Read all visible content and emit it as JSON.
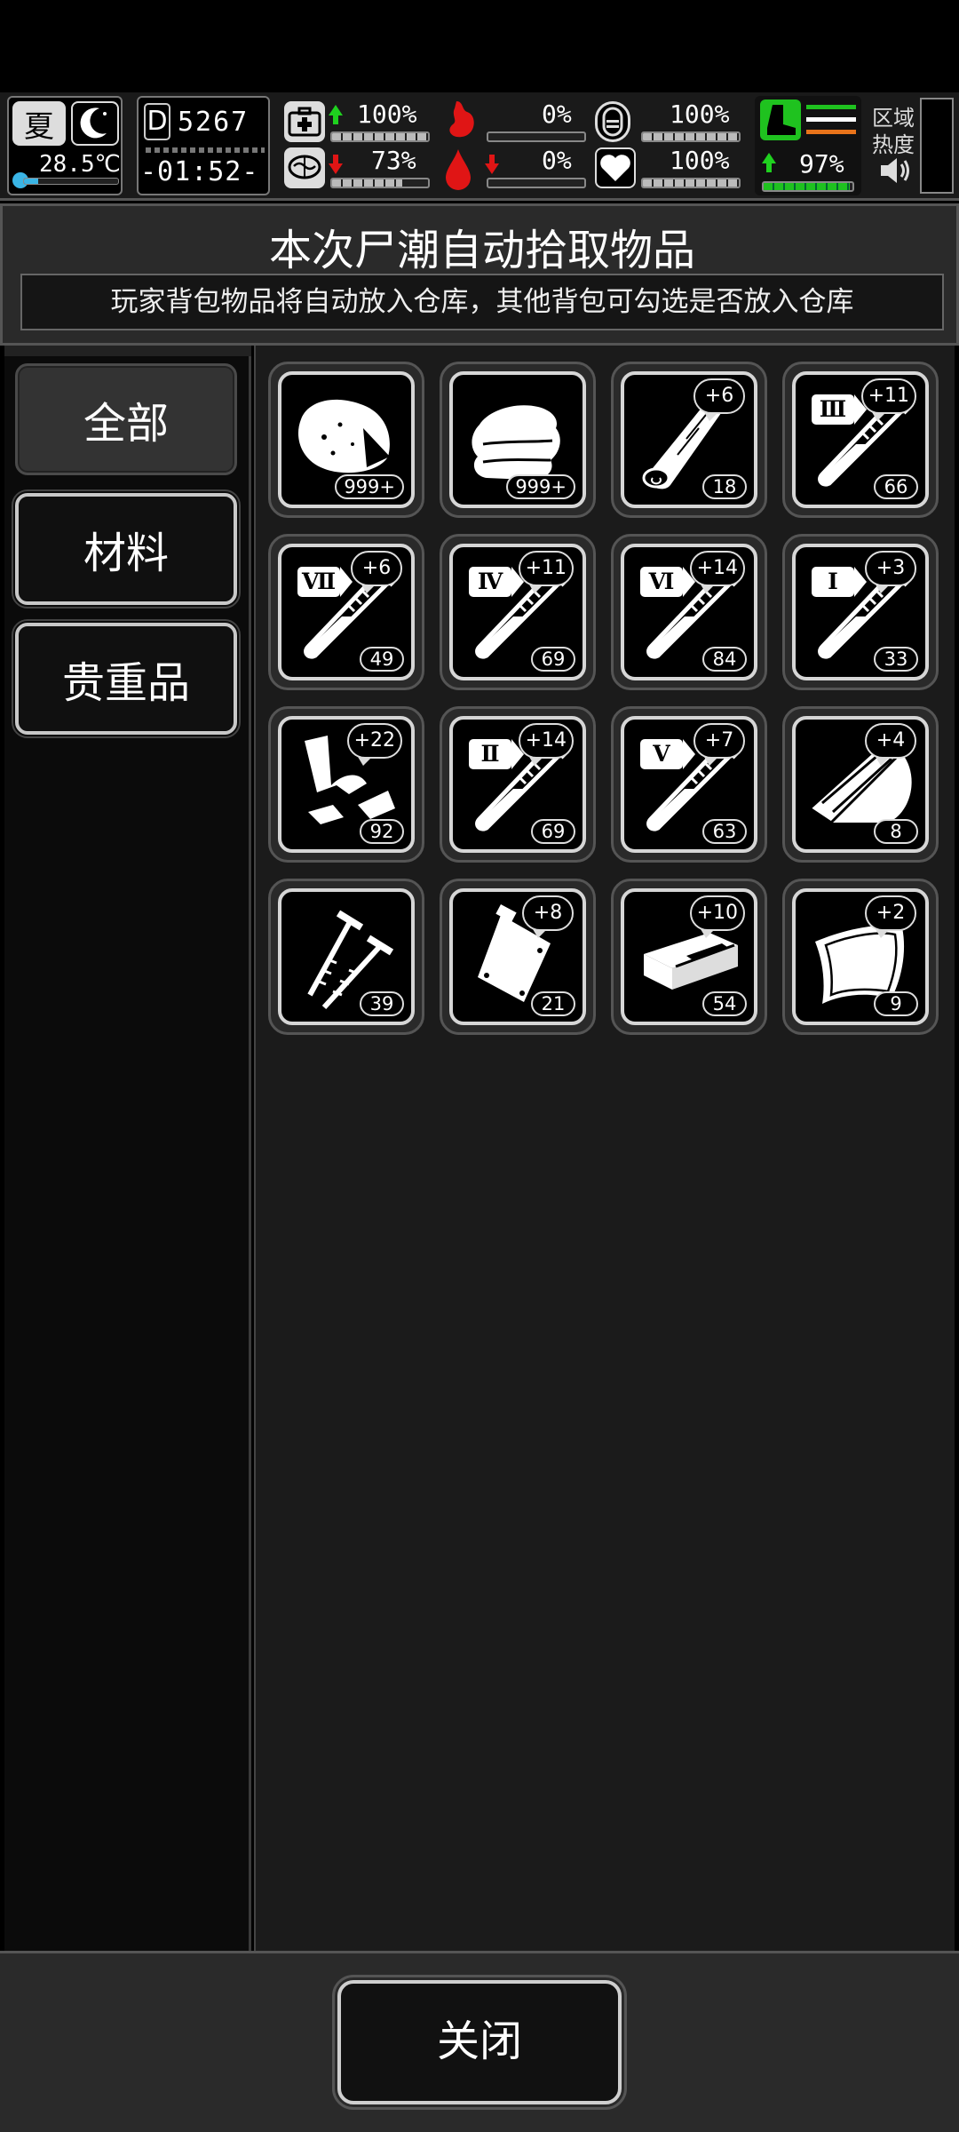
{
  "hud": {
    "season": "夏",
    "temperature": "28.5℃",
    "day": "5267",
    "day_prefix": "D",
    "time": "-01:52-",
    "health": "100%",
    "stomach": "0%",
    "stamina": "100%",
    "mental": "73%",
    "blood": "0%",
    "heart": "100%",
    "energy": "97%",
    "region_heat_label": "区域热度",
    "levels": {
      "health": 1.0,
      "stomach": 0.0,
      "stamina": 1.0,
      "mental": 0.73,
      "blood": 0.0,
      "heart": 1.0,
      "energy": 0.97,
      "temperature": 0.15
    },
    "colors": {
      "up": "#1fd11f",
      "down": "#e01515",
      "energy_bar": "#1fc21f"
    }
  },
  "header": {
    "title": "本次尸潮自动拾取物品",
    "subtitle": "玩家背包物品将自动放入仓库，其他背包可勾选是否放入仓库"
  },
  "sidebar": {
    "tabs": [
      {
        "label": "全部",
        "active": true
      },
      {
        "label": "材料",
        "active": false
      },
      {
        "label": "贵重品",
        "active": false
      }
    ]
  },
  "items": [
    {
      "icon": "meat-icon",
      "count": "999+",
      "bonus": "",
      "roman": ""
    },
    {
      "icon": "cloth-icon",
      "count": "999+",
      "bonus": "",
      "roman": ""
    },
    {
      "icon": "wood-log-icon",
      "count": "18",
      "bonus": "+6",
      "roman": ""
    },
    {
      "icon": "test-tube-icon",
      "count": "66",
      "bonus": "+11",
      "roman": "Ⅲ"
    },
    {
      "icon": "test-tube-icon",
      "count": "49",
      "bonus": "+6",
      "roman": "Ⅶ"
    },
    {
      "icon": "test-tube-icon",
      "count": "69",
      "bonus": "+11",
      "roman": "Ⅳ"
    },
    {
      "icon": "test-tube-icon",
      "count": "84",
      "bonus": "+14",
      "roman": "Ⅵ"
    },
    {
      "icon": "test-tube-icon",
      "count": "33",
      "bonus": "+3",
      "roman": "Ⅰ"
    },
    {
      "icon": "scrap-metal-icon",
      "count": "92",
      "bonus": "+22",
      "roman": ""
    },
    {
      "icon": "test-tube-icon",
      "count": "69",
      "bonus": "+14",
      "roman": "Ⅱ"
    },
    {
      "icon": "test-tube-icon",
      "count": "63",
      "bonus": "+7",
      "roman": "Ⅴ"
    },
    {
      "icon": "wood-plank-icon",
      "count": "8",
      "bonus": "+4",
      "roman": ""
    },
    {
      "icon": "nails-icon",
      "count": "39",
      "bonus": "",
      "roman": ""
    },
    {
      "icon": "metal-plate-icon",
      "count": "21",
      "bonus": "+8",
      "roman": ""
    },
    {
      "icon": "brick-icon",
      "count": "54",
      "bonus": "+10",
      "roman": ""
    },
    {
      "icon": "leather-icon",
      "count": "9",
      "bonus": "+2",
      "roman": ""
    }
  ],
  "footer": {
    "close_label": "关闭"
  }
}
